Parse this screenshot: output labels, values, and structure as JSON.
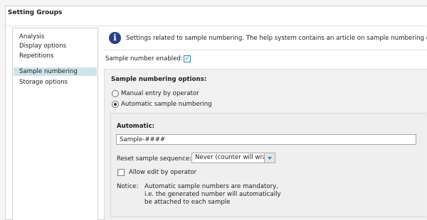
{
  "header": {
    "title": "Setting Groups"
  },
  "sidebar": {
    "items": [
      {
        "label": "Analysis"
      },
      {
        "label": "Display options"
      },
      {
        "label": "Repetitions"
      },
      {
        "label": "Sample numbering"
      },
      {
        "label": "Storage options"
      }
    ],
    "selected": "Sample numbering"
  },
  "info": {
    "icon": "info-icon",
    "text": "Settings related to sample numbering. The help system contains an article on sample numbering options"
  },
  "sample_enabled": {
    "label": "Sample number enabled:",
    "checked": true
  },
  "options": {
    "title": "Sample numbering options:",
    "manual_label": "Manual entry by operator",
    "automatic_label": "Automatic sample numbering",
    "selected": "Automatic sample numbering"
  },
  "automatic": {
    "title": "Automatic:",
    "pattern_value": "Sample-####",
    "reset_label": "Reset sample sequence:",
    "reset_value": "Never (counter will wrap)",
    "allow_edit_label": "Allow edit by operator",
    "allow_edit_checked": false,
    "notice_label": "Notice:",
    "notice_lines": [
      "Automatic sample numbers are mandatory,",
      "i.e. the generated number will automatically",
      "be attached to each sample"
    ]
  },
  "colors": {
    "accent": "#2f8ba0",
    "selection": "#cde4e8",
    "info": "#27408b"
  }
}
